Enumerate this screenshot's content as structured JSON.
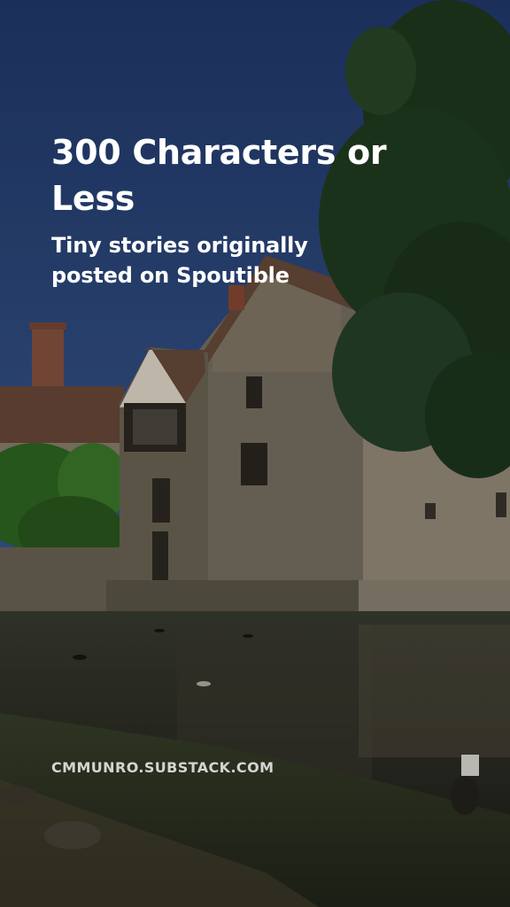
{
  "story_card": {
    "title": "300 Characters or Less",
    "subtitle": "Tiny stories originally posted on Spoutible",
    "footer_url": "CMMUNRO.SUBSTACK.COM"
  },
  "colors": {
    "sky": "#2e4a82",
    "stone": "#7d7566",
    "roof": "#6b4a3a",
    "water": "#2c2e25",
    "grass": "#2f3620",
    "tree": "#233a22",
    "text": "#ffffff"
  }
}
